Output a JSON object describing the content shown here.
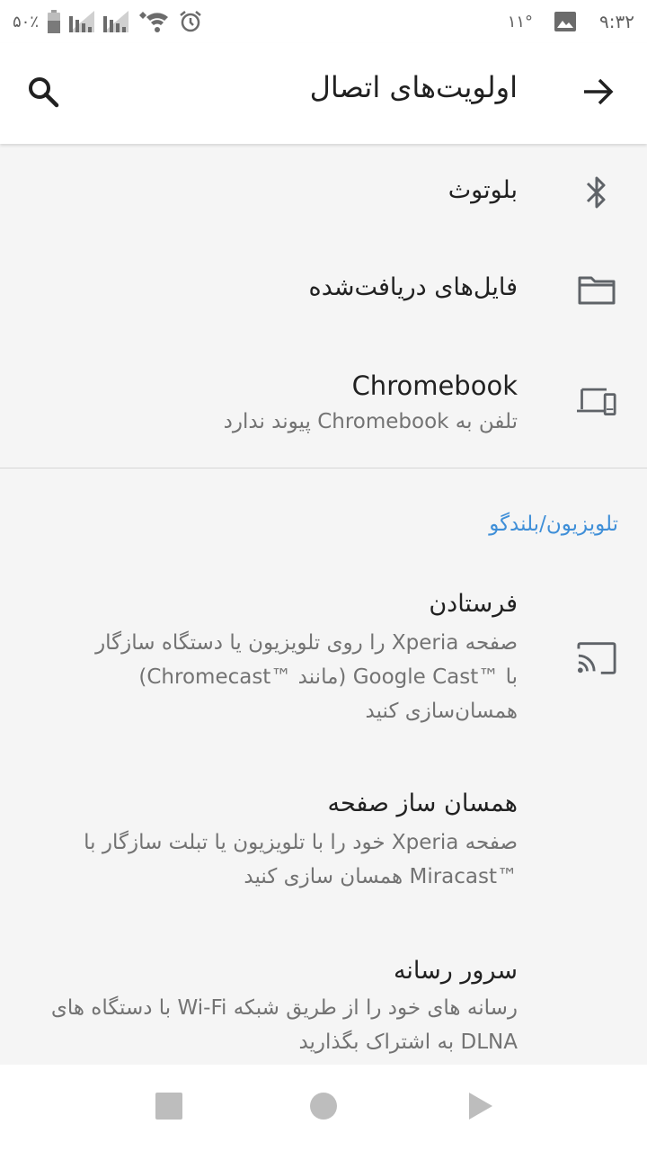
{
  "status_bar": {
    "battery_text": "۵۰٪",
    "notification_temp": "۱۱°",
    "time": "۹:۳۲"
  },
  "header": {
    "title": "اولویت‌های اتصال"
  },
  "items": [
    {
      "title": "بلوتوث",
      "icon": "bluetooth-icon"
    },
    {
      "title": "فایل‌های دریافت‌شده",
      "icon": "folder-icon"
    },
    {
      "title": "Chromebook",
      "subtitle": "تلفن به Chromebook پیوند ندارد",
      "icon": "devices-icon"
    }
  ],
  "section": {
    "header": "تلویزیون/بلندگو",
    "items": [
      {
        "title": "فرستادن",
        "subtitle_lines": [
          "صفحه Xperia را روی تلویزیون یا دستگاه سازگار",
          "با ™Google Cast (مانند ™Chromecast)",
          "همسان‌سازی کنید"
        ],
        "icon": "cast-icon"
      },
      {
        "title": "همسان ساز صفحه",
        "subtitle_lines": [
          "صفحه Xperia خود را با تلویزیون یا تبلت سازگار با",
          "™Miracast همسان سازی کنید"
        ]
      },
      {
        "title": "سرور رسانه",
        "subtitle_lines": [
          "رسانه های خود را از طریق شبکه Wi-Fi با دستگاه های",
          "DLNA به اشتراک بگذارید"
        ]
      }
    ]
  },
  "colors": {
    "accent": "#3f8fd8",
    "icon": "#5f6368",
    "nav_icon": "#bdbdbd"
  }
}
